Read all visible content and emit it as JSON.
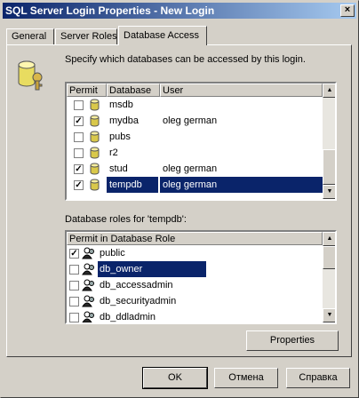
{
  "window": {
    "title": "SQL Server Login Properties - New Login",
    "close_glyph": "×"
  },
  "tabs": [
    {
      "label": "General"
    },
    {
      "label": "Server Roles"
    },
    {
      "label": "Database Access"
    }
  ],
  "instruction": "Specify which databases can be accessed by this login.",
  "db_table": {
    "headers": [
      "Permit",
      "Database",
      "User"
    ],
    "rows": [
      {
        "checked": false,
        "database": "msdb",
        "user": ""
      },
      {
        "checked": true,
        "database": "mydba",
        "user": "oleg german"
      },
      {
        "checked": false,
        "database": "pubs",
        "user": ""
      },
      {
        "checked": false,
        "database": "r2",
        "user": ""
      },
      {
        "checked": true,
        "database": "stud",
        "user": "oleg german"
      },
      {
        "checked": true,
        "database": "tempdb",
        "user": "oleg german",
        "selected": true
      }
    ]
  },
  "roles_label": "Database roles for 'tempdb':",
  "roles_table": {
    "header": "Permit in Database Role",
    "rows": [
      {
        "checked": true,
        "role": "public"
      },
      {
        "checked": false,
        "role": "db_owner",
        "selected": true
      },
      {
        "checked": false,
        "role": "db_accessadmin"
      },
      {
        "checked": false,
        "role": "db_securityadmin"
      },
      {
        "checked": false,
        "role": "db_ddladmin"
      }
    ]
  },
  "buttons": {
    "properties": "Properties",
    "ok": "OK",
    "cancel": "Отмена",
    "help": "Справка"
  },
  "colors": {
    "title_active": "#0a246a",
    "selection": "#0a246a",
    "face": "#d4d0c8"
  },
  "icons": {
    "db_icon": "database-cylinder-icon",
    "role_icon": "user-role-icon"
  }
}
